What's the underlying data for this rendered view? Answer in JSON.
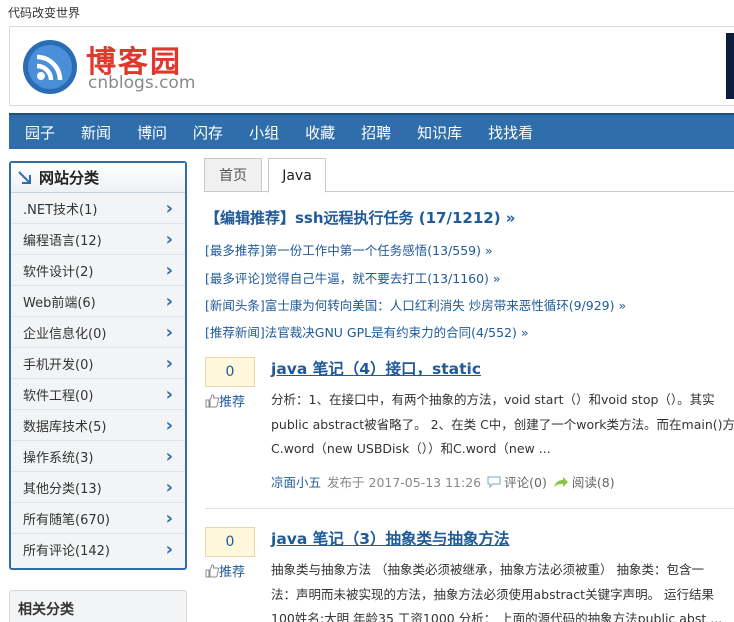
{
  "site": {
    "tagline": "代码改变世界",
    "logo_cn": "博客园",
    "logo_en": "cnblogs.com"
  },
  "nav": [
    "园子",
    "新闻",
    "博问",
    "闪存",
    "小组",
    "收藏",
    "招聘",
    "知识库",
    "找找看"
  ],
  "sidebar": {
    "title": "网站分类",
    "items": [
      ".NET技术(1)",
      "编程语言(12)",
      "软件设计(2)",
      "Web前端(6)",
      "企业信息化(0)",
      "手机开发(0)",
      "软件工程(0)",
      "数据库技术(5)",
      "操作系统(3)",
      "其他分类(13)",
      "所有随笔(670)",
      "所有评论(142)"
    ],
    "related_title": "相关分类"
  },
  "tabs": {
    "home": "首页",
    "active": "Java"
  },
  "editor_pick": "【编辑推荐】ssh远程执行任务 (17/1212) »",
  "recommendations": [
    "[最多推荐]第一份工作中第一个任务感悟(13/559) »",
    "[最多评论]觉得自己牛逼，就不要去打工(13/1160) »",
    "[新闻头条]富士康为何转向美国：人口红利消失 炒房带来恶性循环(9/929) »",
    "[推荐新闻]法官裁决GNU GPL是有约束力的合同(4/552) »"
  ],
  "posts": [
    {
      "votes": "0",
      "vote_label": "推荐",
      "title": "java 笔记（4）接口，static",
      "summary": [
        "分析：1、在接口中，有两个抽象的方法，void start（）和void stop（）。其实",
        "public abstract被省略了。 2、在类 C中，创建了一个work类方法。而在main()方",
        "C.word（new USBDisk（））和C.word（new ..."
      ],
      "author": "凉面小五",
      "posted": "发布于 2017-05-13 11:26",
      "comments": "评论(0)",
      "reads": "阅读(8)"
    },
    {
      "votes": "0",
      "vote_label": "推荐",
      "title": "java 笔记（3）抽象类与抽象方法",
      "summary": [
        "抽象类与抽象方法 （抽象类必须被继承，抽象方法必须被重） 抽象类：包含一",
        "法：声明而未被实现的方法，抽象方法必须使用abstract关键字声明。 运行结果",
        "100姓名:大明 年龄35 工资1000 分析： 上面的源代码的抽象方法public abst ..."
      ]
    }
  ],
  "colors": {
    "brand": "#e0382c",
    "nav": "#2f6eaa",
    "link": "#1f5a99"
  }
}
